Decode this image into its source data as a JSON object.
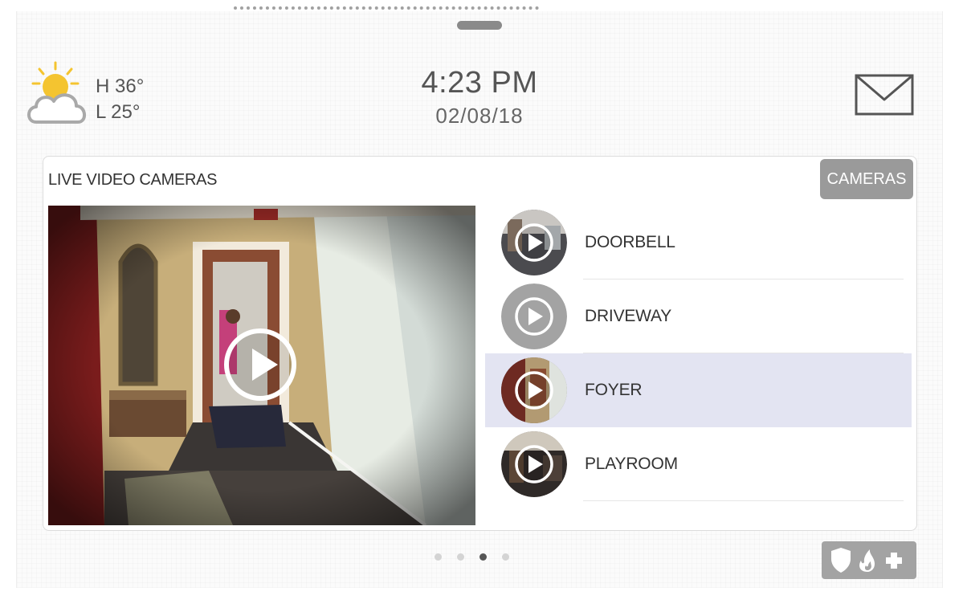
{
  "weather": {
    "high": "H 36°",
    "low": "L 25°",
    "icon": "partly-cloudy-icon"
  },
  "header": {
    "time": "4:23 PM",
    "date": "02/08/18",
    "mail_icon": "mail-icon"
  },
  "panel": {
    "title": "LIVE VIDEO CAMERAS",
    "cameras_button": "CAMERAS",
    "video": {
      "timestamp": "",
      "play_icon": "play-icon"
    },
    "cameras": [
      {
        "label": "DOORBELL",
        "selected": false
      },
      {
        "label": "DRIVEWAY",
        "selected": false
      },
      {
        "label": "FOYER",
        "selected": true
      },
      {
        "label": "PLAYROOM",
        "selected": false
      }
    ]
  },
  "pager": {
    "count": 4,
    "active_index": 2
  },
  "emergency": {
    "icons": [
      "shield-icon",
      "fire-icon",
      "medical-cross-icon"
    ]
  },
  "colors": {
    "selected_row": "#e3e4f2",
    "button_gray": "#9a9a9a",
    "sun": "#f4c430"
  }
}
